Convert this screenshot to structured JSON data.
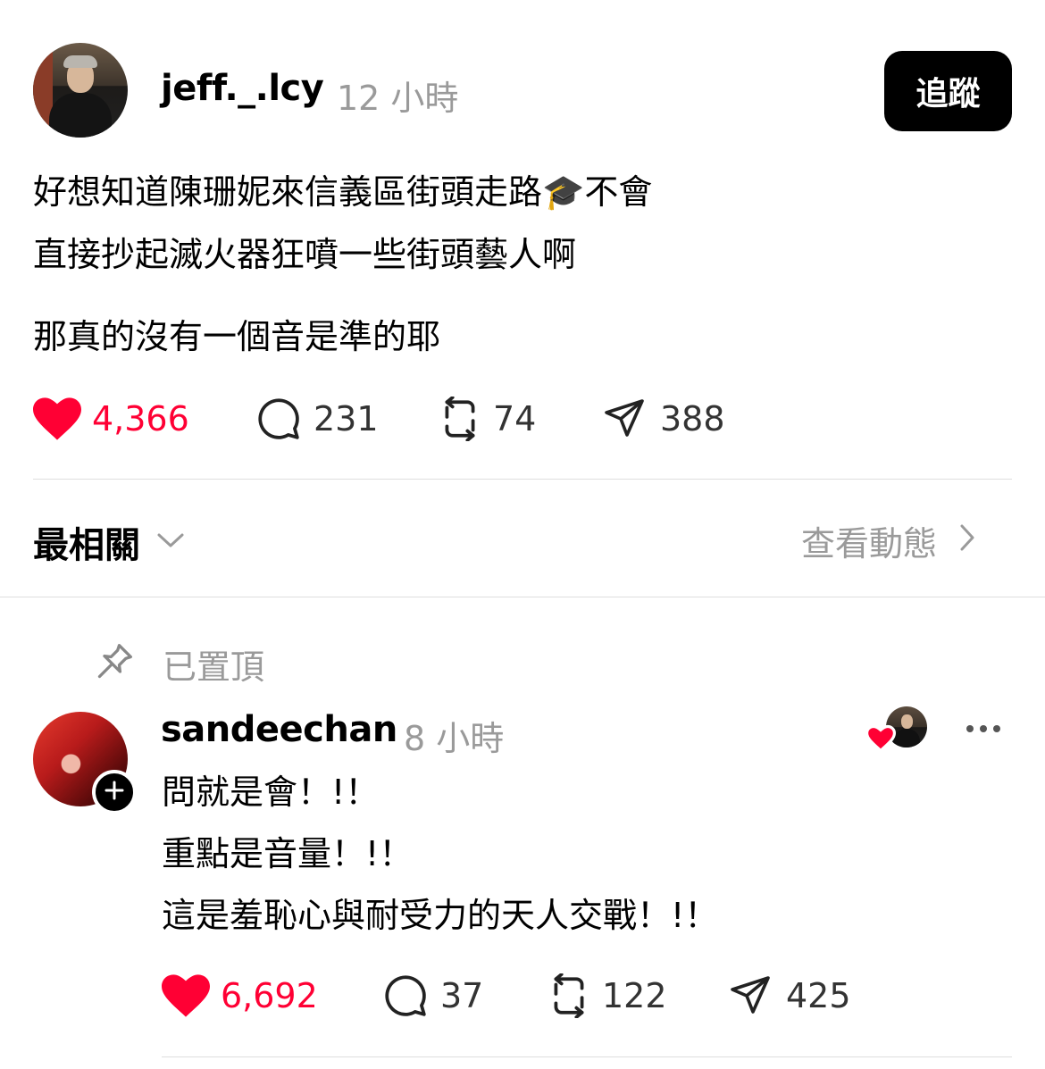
{
  "post": {
    "username": "jeff._.lcy",
    "time": "12 小時",
    "follow_label": "追蹤",
    "lines": [
      "好想知道陳珊妮來信義區街頭走路🎓不會",
      "直接抄起滅火器狂噴一些街頭藝人啊",
      "那真的沒有一個音是準的耶"
    ],
    "stats": {
      "likes": "4,366",
      "comments": "231",
      "reposts": "74",
      "shares": "388"
    }
  },
  "filter": {
    "sort_label": "最相關",
    "activity_label": "查看動態"
  },
  "reply": {
    "pinned_label": "已置頂",
    "username": "sandeechan",
    "time": "8 小時",
    "lines": [
      "問就是會！!！",
      "重點是音量！!！",
      "這是羞恥心與耐受力的天人交戰！!！"
    ],
    "stats": {
      "likes": "6,692",
      "comments": "37",
      "reposts": "122",
      "shares": "425"
    }
  },
  "colors": {
    "like_red": "#ff0034",
    "muted_gray": "#9a9a9a",
    "divider": "#dedede"
  },
  "icons": [
    "heart-icon",
    "comment-icon",
    "repost-icon",
    "share-icon",
    "chevron-down-icon",
    "chevron-right-icon",
    "pin-icon",
    "plus-icon",
    "more-icon"
  ]
}
